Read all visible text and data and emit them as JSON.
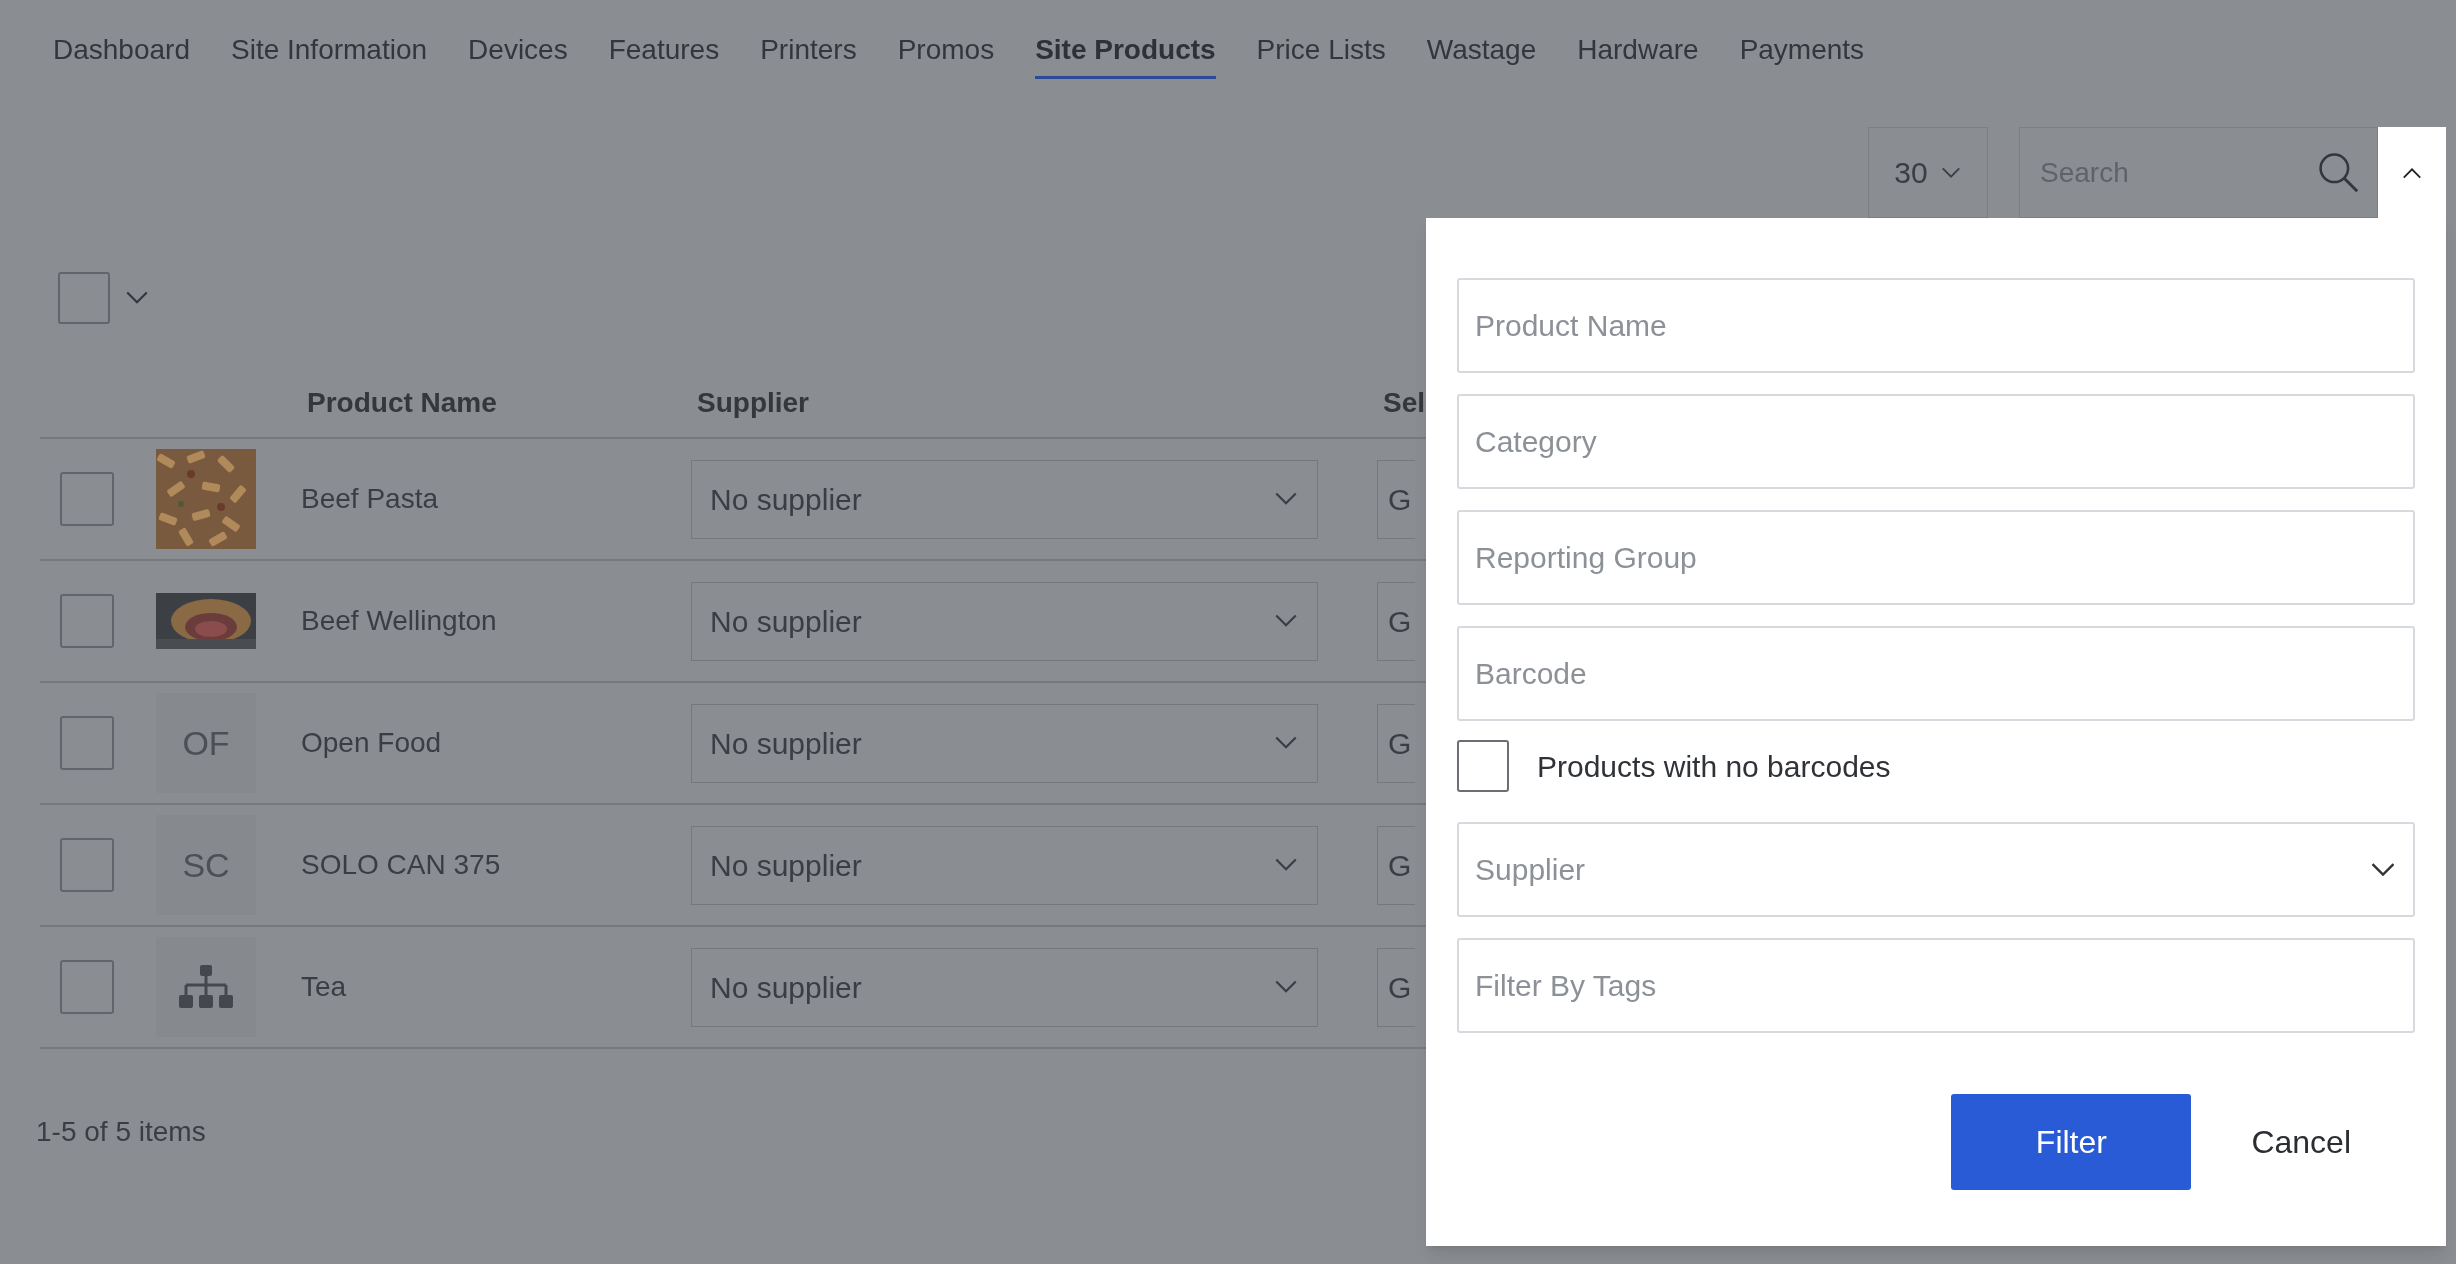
{
  "tabs": [
    {
      "label": "Dashboard",
      "selected": false
    },
    {
      "label": "Site Information",
      "selected": false
    },
    {
      "label": "Devices",
      "selected": false
    },
    {
      "label": "Features",
      "selected": false
    },
    {
      "label": "Printers",
      "selected": false
    },
    {
      "label": "Promos",
      "selected": false
    },
    {
      "label": "Site Products",
      "selected": true
    },
    {
      "label": "Price Lists",
      "selected": false
    },
    {
      "label": "Wastage",
      "selected": false
    },
    {
      "label": "Hardware",
      "selected": false
    },
    {
      "label": "Payments",
      "selected": false
    }
  ],
  "toolbar": {
    "page_size": "30",
    "search": {
      "placeholder": "Search"
    },
    "filter_toggle": {
      "expanded": true
    }
  },
  "select_all": {
    "checked": false
  },
  "table": {
    "columns": [
      "Product Name",
      "Supplier",
      "Sel"
    ],
    "rows": [
      {
        "checked": false,
        "name": "Beef Pasta",
        "supplier": "No supplier",
        "column_3": "G"
      },
      {
        "checked": false,
        "name": "Beef Wellington",
        "supplier": "No supplier",
        "column_3": "G"
      },
      {
        "checked": false,
        "thumb": {
          "kind": "initials",
          "text": "OF"
        },
        "name": "Open Food",
        "supplier": "No supplier",
        "column_3": "G"
      },
      {
        "checked": false,
        "thumb": {
          "kind": "initials",
          "text": "SC"
        },
        "name": "SOLO CAN 375",
        "supplier": "No supplier",
        "column_3": "G"
      },
      {
        "checked": false,
        "thumb": {
          "kind": "icon"
        },
        "name": "Tea",
        "supplier": "No supplier",
        "column_3": "G"
      }
    ]
  },
  "pagination": "1-5 of 5 items",
  "filter_panel": {
    "fields": [
      {
        "kind": "text",
        "placeholder": "Product Name"
      },
      {
        "kind": "text",
        "placeholder": "Category"
      },
      {
        "kind": "text",
        "placeholder": "Reporting Group"
      },
      {
        "kind": "text",
        "placeholder": "Barcode"
      },
      {
        "kind": "checkbox",
        "label": "Products with no barcodes",
        "checked": false
      },
      {
        "kind": "select",
        "placeholder": "Supplier"
      },
      {
        "kind": "text",
        "placeholder": "Filter By Tags"
      }
    ],
    "buttons": [
      {
        "kind": "primary",
        "label": "Filter"
      },
      {
        "kind": "plain",
        "label": "Cancel"
      }
    ]
  }
}
